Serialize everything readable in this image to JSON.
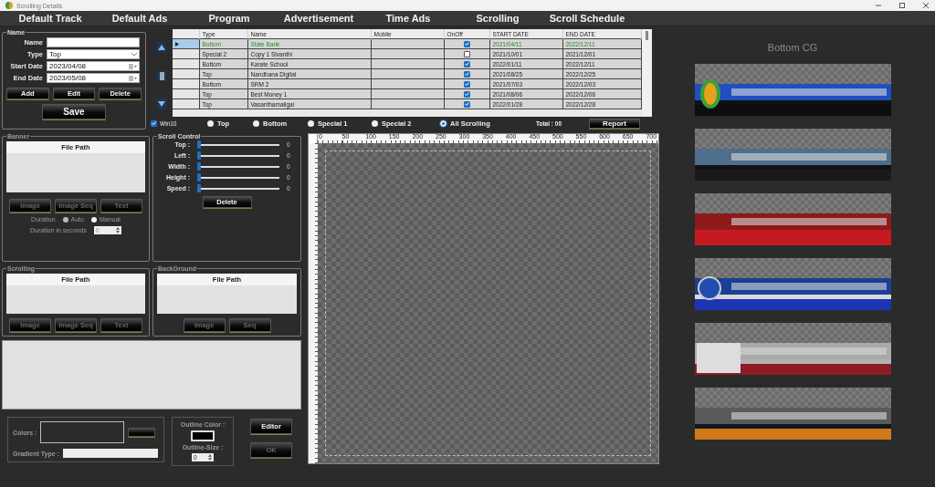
{
  "window": {
    "title": "Scrolling Details"
  },
  "menu": [
    {
      "label": "Default Track"
    },
    {
      "label": "Default Ads"
    },
    {
      "label": "Program"
    },
    {
      "label": "Advertisement"
    },
    {
      "label": "Time Ads"
    },
    {
      "label": "Scrolling"
    },
    {
      "label": "Scroll Schedule"
    }
  ],
  "name_panel": {
    "legend": "Name",
    "fields": [
      {
        "label": "Name",
        "kind": "text"
      },
      {
        "label": "Type",
        "kind": "dropdown",
        "value": "Top"
      },
      {
        "label": "Start Date",
        "kind": "date",
        "value": "2023/04/08"
      },
      {
        "label": "End Date",
        "kind": "date",
        "value": "2023/05/08"
      }
    ],
    "buttons": [
      "Add",
      "Edit",
      "Delete"
    ],
    "save_button": "Save"
  },
  "table": {
    "columns": [
      "Type",
      "Name",
      "Mobile",
      "OnOff",
      "START DATE",
      "END DATE"
    ],
    "rows": [
      {
        "type": "Bottom",
        "name": "State Bank",
        "on": true,
        "start": "2021/04/11",
        "end": "2022/12/11",
        "selected": true
      },
      {
        "type": "Special 2",
        "name": "Copy 1 Sivanthi",
        "on": false,
        "start": "2021/10/01",
        "end": "2021/12/01",
        "selected": false
      },
      {
        "type": "Bottom",
        "name": "Karate School",
        "on": true,
        "start": "2022/01/11",
        "end": "2022/12/11",
        "selected": false
      },
      {
        "type": "Top",
        "name": "Nandhana Digital",
        "on": true,
        "start": "2021/08/25",
        "end": "2022/12/25",
        "selected": false
      },
      {
        "type": "Bottom",
        "name": "SRM 2",
        "on": true,
        "start": "2021/07/03",
        "end": "2022/12/03",
        "selected": false
      },
      {
        "type": "Top",
        "name": "Best Money 1",
        "on": true,
        "start": "2021/08/06",
        "end": "2022/12/06",
        "selected": false
      },
      {
        "type": "Top",
        "name": "Vasanthamaligai",
        "on": true,
        "start": "2022/01/28",
        "end": "2022/12/28",
        "selected": false
      }
    ]
  },
  "win10": {
    "label": "Win10",
    "checked": true
  },
  "filters": [
    {
      "label": "Top",
      "selected": false
    },
    {
      "label": "Bottom",
      "selected": false
    },
    {
      "label": "Special 1",
      "selected": false
    },
    {
      "label": "Special 2",
      "selected": false
    },
    {
      "label": "All Scrolling",
      "selected": true
    }
  ],
  "total": "Total : 00",
  "report_button": "Report",
  "banner_panel": {
    "legend": "Banner",
    "header": "File Path",
    "buttons": [
      {
        "label": "Image",
        "disabled": true
      },
      {
        "label": "Image Seq",
        "disabled": true
      },
      {
        "label": "Text",
        "disabled": true
      }
    ],
    "duration_label": "Duration",
    "duration_options": [
      {
        "label": "Auto",
        "selected": true
      },
      {
        "label": "Manual",
        "selected": false
      }
    ],
    "seconds_label": "Duration in seconds",
    "seconds_value": "0"
  },
  "scroll_control": {
    "legend": "Scroll Control",
    "sliders": [
      {
        "label": "Top :",
        "level": 0,
        "reading": "0"
      },
      {
        "label": "Left :",
        "level": 0,
        "reading": "0"
      },
      {
        "label": "Width :",
        "level": 0,
        "reading": "0"
      },
      {
        "label": "Height :",
        "level": 0,
        "reading": "0"
      },
      {
        "label": "Speed :",
        "level": 0,
        "reading": "0"
      }
    ],
    "delete_button": "Delete"
  },
  "scrolling_panel": {
    "legend": "Scrolling",
    "header": "File Path",
    "buttons": [
      {
        "label": "Image",
        "disabled": true
      },
      {
        "label": "Image Seq",
        "disabled": true
      },
      {
        "label": "Text",
        "disabled": true
      }
    ]
  },
  "background_panel": {
    "legend": "BackGround",
    "header": "File Path",
    "buttons": [
      {
        "label": "Image",
        "disabled": true
      },
      {
        "label": "Seq",
        "disabled": true
      }
    ]
  },
  "colors": {
    "label": "Colors :",
    "gradient_label": "Gradient Type :"
  },
  "outline": {
    "color_label": "Outline Color :",
    "color": "#000000",
    "size_label": "Outline-Size :",
    "size_value": "0"
  },
  "editor_button": {
    "label": "Editor",
    "disabled": false
  },
  "ok_button": {
    "label": "OK",
    "disabled": true
  },
  "canvas": {
    "ruler_labels": [
      "0",
      "50",
      "100",
      "150",
      "200",
      "250",
      "300",
      "350",
      "400",
      "450",
      "500",
      "550",
      "600",
      "650",
      "700"
    ]
  },
  "cg_panel": {
    "title": "Bottom CG",
    "previews": [
      {
        "kind": "blue"
      },
      {
        "kind": "steel"
      },
      {
        "kind": "red"
      },
      {
        "kind": "round"
      },
      {
        "kind": "silver"
      },
      {
        "kind": "pill"
      }
    ]
  }
}
